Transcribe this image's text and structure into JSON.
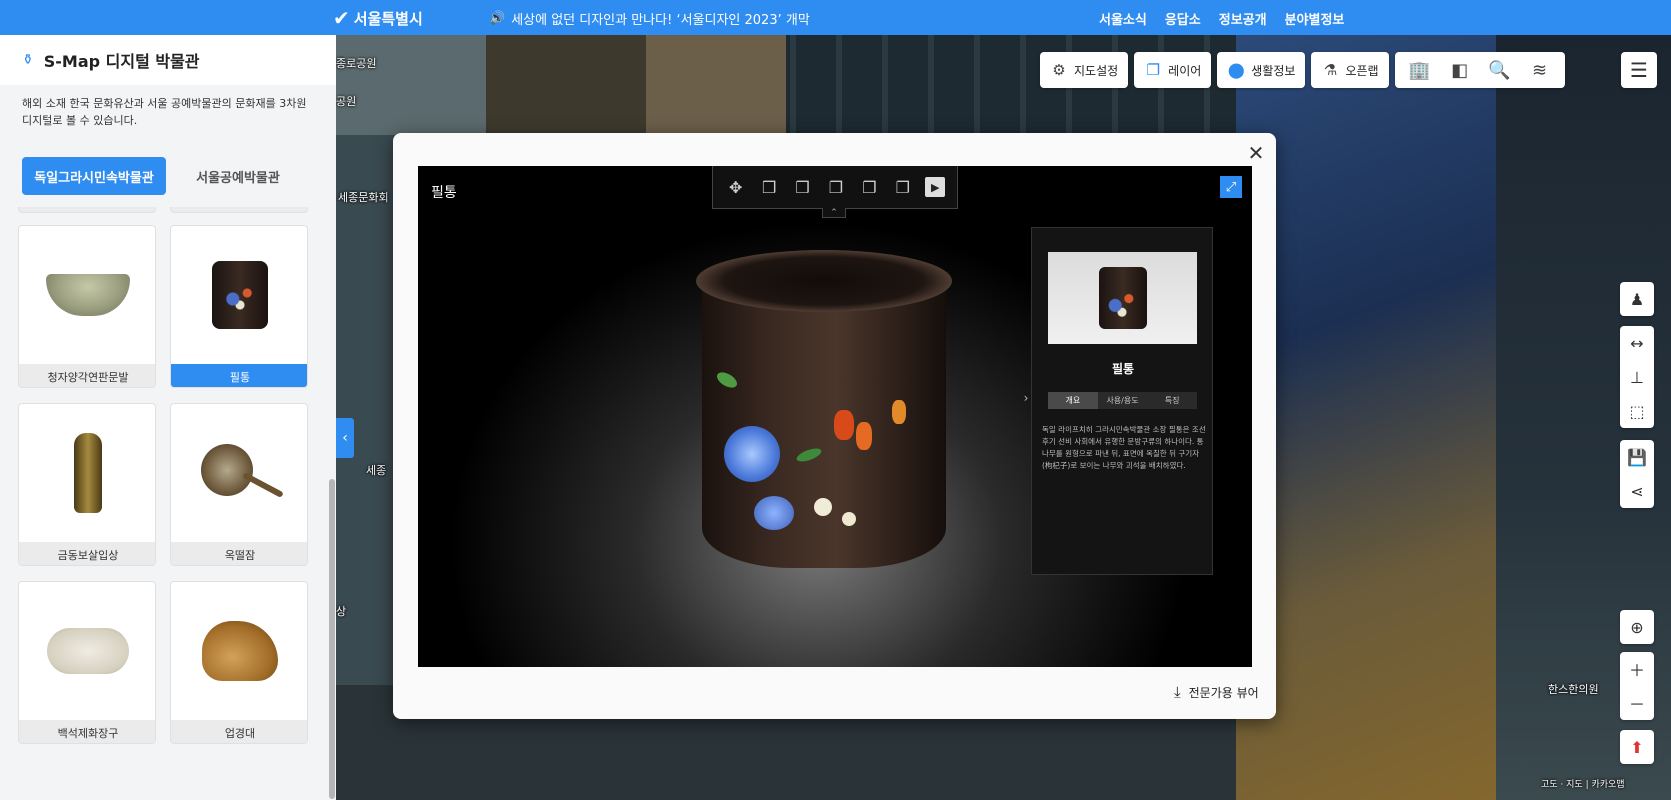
{
  "topbar": {
    "logo_text": "서울특별시",
    "notice": "세상에 없던 디자인과 만나다! ‘서울디자인 2023’ 개막",
    "nav": [
      "서울소식",
      "응답소",
      "정보공개",
      "분야별정보"
    ]
  },
  "left_panel": {
    "title": "S-Map 디지털 박물관",
    "description": "해외 소재 한국 문화유산과 서울 공예박물관의 문화재를 3차원 디지털로 볼 수 있습니다.",
    "tabs": [
      {
        "label": "독일그라시민속박물관",
        "active": true
      },
      {
        "label": "서울공예박물관",
        "active": false
      }
    ],
    "items": [
      {
        "label": "청자양각연판문발",
        "selected": false
      },
      {
        "label": "필통",
        "selected": true
      },
      {
        "label": "금동보살입상",
        "selected": false
      },
      {
        "label": "옥떨잠",
        "selected": false
      },
      {
        "label": "백석제화장구",
        "selected": false
      },
      {
        "label": "업경대",
        "selected": false
      }
    ]
  },
  "map_toolbar": {
    "buttons": [
      {
        "label": "지도설정",
        "icon": "gear-icon"
      },
      {
        "label": "레이어",
        "icon": "layers-icon"
      },
      {
        "label": "생활정보",
        "icon": "info-pin-icon"
      },
      {
        "label": "오픈랩",
        "icon": "flask-icon"
      }
    ]
  },
  "map_labels": [
    "종로공원",
    "공원",
    "세종문화회",
    "세종",
    "상",
    "한스한의원",
    "고도 · 지도 | 카카오맵"
  ],
  "viewer": {
    "title": "필통",
    "item_name": "필통",
    "info_tabs": [
      {
        "label": "개요",
        "active": true
      },
      {
        "label": "사용/용도",
        "active": false
      },
      {
        "label": "특징",
        "active": false
      }
    ],
    "info_text": "독일 라이프치히 그라시민속박물관 소장 필통은 조선 후기 선비 사회에서 유행한 문방구류의 하나이다. 통나무를 원형으로 파낸 뒤, 표면에 옥칠한 뒤 구기자(枸杞子)로 보이는 나무와 괴석을 배치하였다.",
    "download_label": "전문가용 뷰어"
  },
  "colors": {
    "brand_blue": "#2f8cf0",
    "panel_bg": "#f3f4f6"
  }
}
